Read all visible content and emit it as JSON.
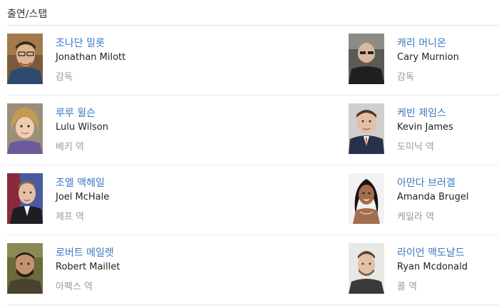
{
  "section_title": "출연/스탭",
  "people": [
    {
      "korean_name": "조나단 밀롯",
      "english_name": "Jonathan Milott",
      "role": "감독",
      "photo": "portrait-jonathan-milott"
    },
    {
      "korean_name": "캐리 머니온",
      "english_name": "Cary Murnion",
      "role": "감독",
      "photo": "portrait-cary-murnion"
    },
    {
      "korean_name": "루루 윌슨",
      "english_name": "Lulu Wilson",
      "role": "베키 역",
      "photo": "portrait-lulu-wilson"
    },
    {
      "korean_name": "케빈 제임스",
      "english_name": "Kevin James",
      "role": "도미닉 역",
      "photo": "portrait-kevin-james"
    },
    {
      "korean_name": "조엘 맥헤일",
      "english_name": "Joel McHale",
      "role": "제프 역",
      "photo": "portrait-joel-mchale"
    },
    {
      "korean_name": "아만다 브러겔",
      "english_name": "Amanda Brugel",
      "role": "케일라 역",
      "photo": "portrait-amanda-brugel"
    },
    {
      "korean_name": "로버트 메일렛",
      "english_name": "Robert Maillet",
      "role": "아펙스 역",
      "photo": "portrait-robert-maillet"
    },
    {
      "korean_name": "라이언 맥도날드",
      "english_name": "Ryan Mcdonald",
      "role": "콜 역",
      "photo": "portrait-ryan-mcdonald"
    }
  ],
  "colors": {
    "name_link": "#3a78c3",
    "english_name": "#222222",
    "role": "#999999",
    "divider": "#e8e8e8"
  }
}
